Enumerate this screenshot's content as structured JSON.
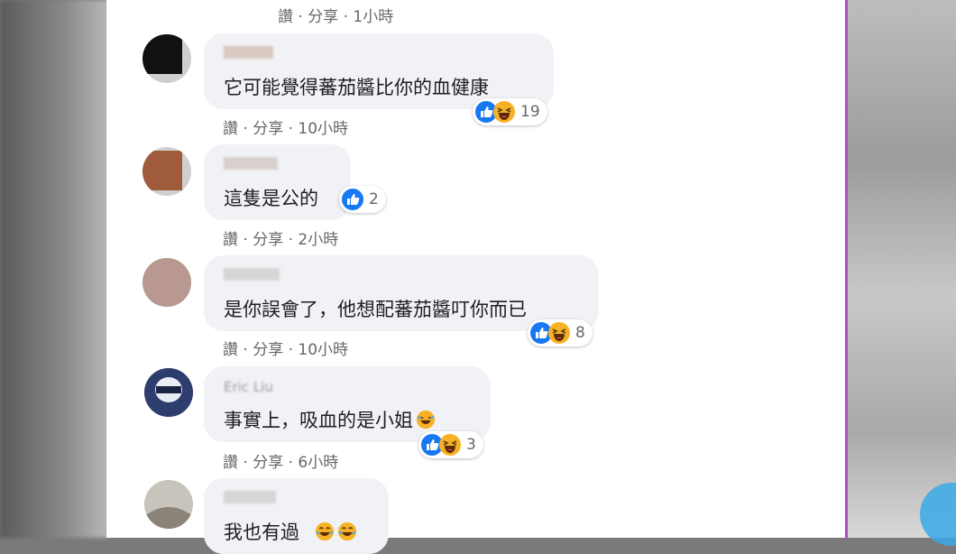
{
  "top_meta": {
    "text": "讚 · 分享 · 1小時"
  },
  "comments": [
    {
      "author": "",
      "text": "它可能覺得蕃茄醬比你的血健康",
      "meta": "讚 · 分享 · 10小時",
      "reaction_count": "19",
      "reactions": [
        "like-icon",
        "haha-icon"
      ]
    },
    {
      "author": "",
      "text": "這隻是公的",
      "meta": "讚 · 分享 · 2小時",
      "reaction_count": "2",
      "reactions": [
        "like-icon"
      ]
    },
    {
      "author": "",
      "text": "是你誤會了，他想配蕃茄醬叮你而已",
      "meta": "讚 · 分享 · 10小時",
      "reaction_count": "8",
      "reactions": [
        "like-icon",
        "haha-icon"
      ]
    },
    {
      "author": "Eric Liu",
      "text": "事實上，吸血的是小姐",
      "meta": "讚 · 分享 · 6小時",
      "reaction_count": "3",
      "reactions": [
        "like-icon",
        "haha-icon"
      ]
    },
    {
      "author": "",
      "text": "我也有過",
      "meta": "",
      "reaction_count": "",
      "reactions": []
    }
  ],
  "colors": {
    "like": "#1877f2",
    "haha": "#f7b125",
    "bubble": "#f0f2f5",
    "meta": "#65676b",
    "panel_edge": "#c040d8"
  }
}
